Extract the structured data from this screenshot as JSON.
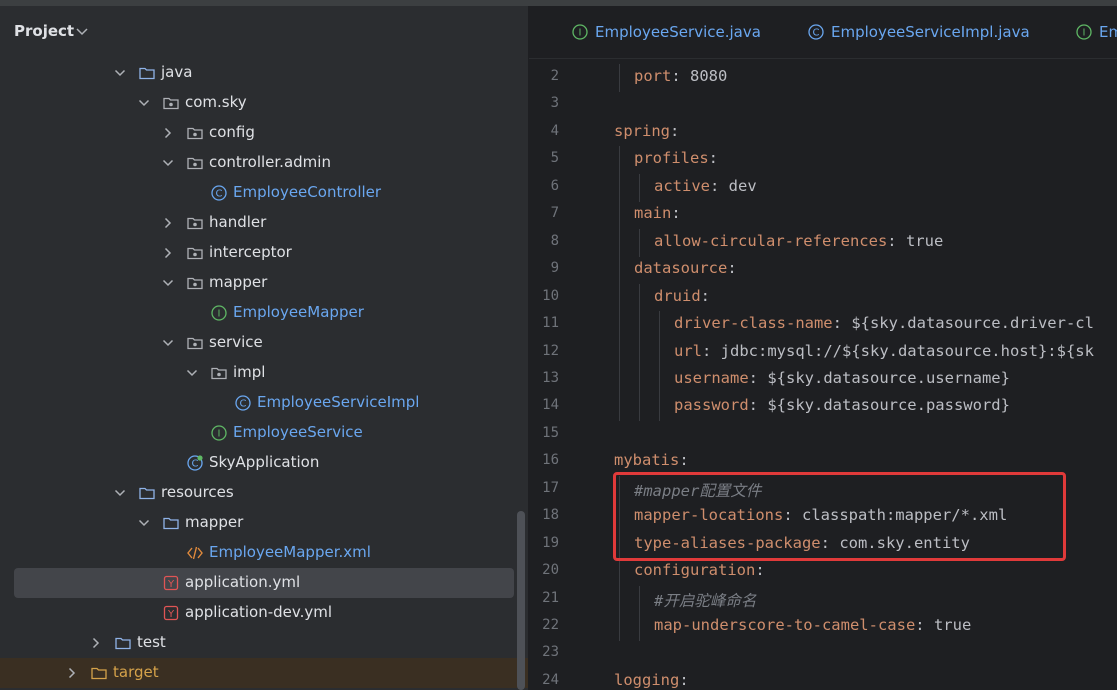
{
  "project_panel": {
    "title": "Project",
    "tree": [
      {
        "label": "java",
        "type": "folder",
        "expanded": true,
        "depth": 1
      },
      {
        "label": "com.sky",
        "type": "package",
        "expanded": true,
        "depth": 2
      },
      {
        "label": "config",
        "type": "package",
        "expanded": false,
        "depth": 3
      },
      {
        "label": "controller.admin",
        "type": "package",
        "expanded": true,
        "depth": 3
      },
      {
        "label": "EmployeeController",
        "type": "class",
        "depth": 4
      },
      {
        "label": "handler",
        "type": "package",
        "expanded": false,
        "depth": 3
      },
      {
        "label": "interceptor",
        "type": "package",
        "expanded": false,
        "depth": 3
      },
      {
        "label": "mapper",
        "type": "package",
        "expanded": true,
        "depth": 3
      },
      {
        "label": "EmployeeMapper",
        "type": "interface",
        "depth": 4
      },
      {
        "label": "service",
        "type": "package",
        "expanded": true,
        "depth": 3
      },
      {
        "label": "impl",
        "type": "package",
        "expanded": true,
        "depth": 4
      },
      {
        "label": "EmployeeServiceImpl",
        "type": "class",
        "depth": 5
      },
      {
        "label": "EmployeeService",
        "type": "interface",
        "depth": 4
      },
      {
        "label": "SkyApplication",
        "type": "spring-class",
        "depth": 3
      },
      {
        "label": "resources",
        "type": "folder",
        "expanded": true,
        "depth": 1
      },
      {
        "label": "mapper",
        "type": "folder",
        "expanded": true,
        "depth": 2
      },
      {
        "label": "EmployeeMapper.xml",
        "type": "xml",
        "depth": 3
      },
      {
        "label": "application.yml",
        "type": "yaml",
        "depth": 2,
        "selected": true
      },
      {
        "label": "application-dev.yml",
        "type": "yaml",
        "depth": 2
      },
      {
        "label": "test",
        "type": "folder",
        "expanded": false,
        "depth": 0
      },
      {
        "label": "target",
        "type": "folder-excluded",
        "expanded": false,
        "depth": -1
      }
    ]
  },
  "editor": {
    "tabs": [
      {
        "label": "EmployeeService.java",
        "type": "interface"
      },
      {
        "label": "EmployeeServiceImpl.java",
        "type": "class"
      },
      {
        "label": "Em",
        "type": "interface"
      }
    ],
    "lines": [
      {
        "num": "2",
        "indent": 1,
        "key": "port",
        "val": " 8080"
      },
      {
        "num": "3",
        "indent": 0,
        "key": "",
        "val": ""
      },
      {
        "num": "4",
        "indent": 0,
        "key": "spring",
        "val": ""
      },
      {
        "num": "5",
        "indent": 1,
        "key": "profiles",
        "val": ""
      },
      {
        "num": "6",
        "indent": 2,
        "key": "active",
        "val": " dev"
      },
      {
        "num": "7",
        "indent": 1,
        "key": "main",
        "val": ""
      },
      {
        "num": "8",
        "indent": 2,
        "key": "allow-circular-references",
        "val": " true"
      },
      {
        "num": "9",
        "indent": 1,
        "key": "datasource",
        "val": ""
      },
      {
        "num": "10",
        "indent": 2,
        "key": "druid",
        "val": ""
      },
      {
        "num": "11",
        "indent": 3,
        "key": "driver-class-name",
        "val": " ${sky.datasource.driver-cl"
      },
      {
        "num": "12",
        "indent": 3,
        "key": "url",
        "val": " jdbc:mysql://${sky.datasource.host}:${sk"
      },
      {
        "num": "13",
        "indent": 3,
        "key": "username",
        "val": " ${sky.datasource.username}"
      },
      {
        "num": "14",
        "indent": 3,
        "key": "password",
        "val": " ${sky.datasource.password}"
      },
      {
        "num": "15",
        "indent": 0,
        "key": "",
        "val": ""
      },
      {
        "num": "16",
        "indent": 0,
        "key": "mybatis",
        "val": ""
      },
      {
        "num": "17",
        "indent": 1,
        "comment": "#mapper配置文件"
      },
      {
        "num": "18",
        "indent": 1,
        "key": "mapper-locations",
        "val": " classpath:mapper/*.xml"
      },
      {
        "num": "19",
        "indent": 1,
        "key": "type-aliases-package",
        "val": " com.sky.entity"
      },
      {
        "num": "20",
        "indent": 1,
        "key": "configuration",
        "val": ""
      },
      {
        "num": "21",
        "indent": 2,
        "comment": "#开启驼峰命名"
      },
      {
        "num": "22",
        "indent": 2,
        "key": "map-underscore-to-camel-case",
        "val": " true"
      },
      {
        "num": "23",
        "indent": 0,
        "key": "",
        "val": ""
      },
      {
        "num": "24",
        "indent": 0,
        "key": "logging",
        "val": ""
      }
    ]
  },
  "colors": {
    "highlight_box": "#e03a3a",
    "key": "#cf8e6d",
    "comment": "#7a7e85",
    "link": "#6aa7f0"
  }
}
